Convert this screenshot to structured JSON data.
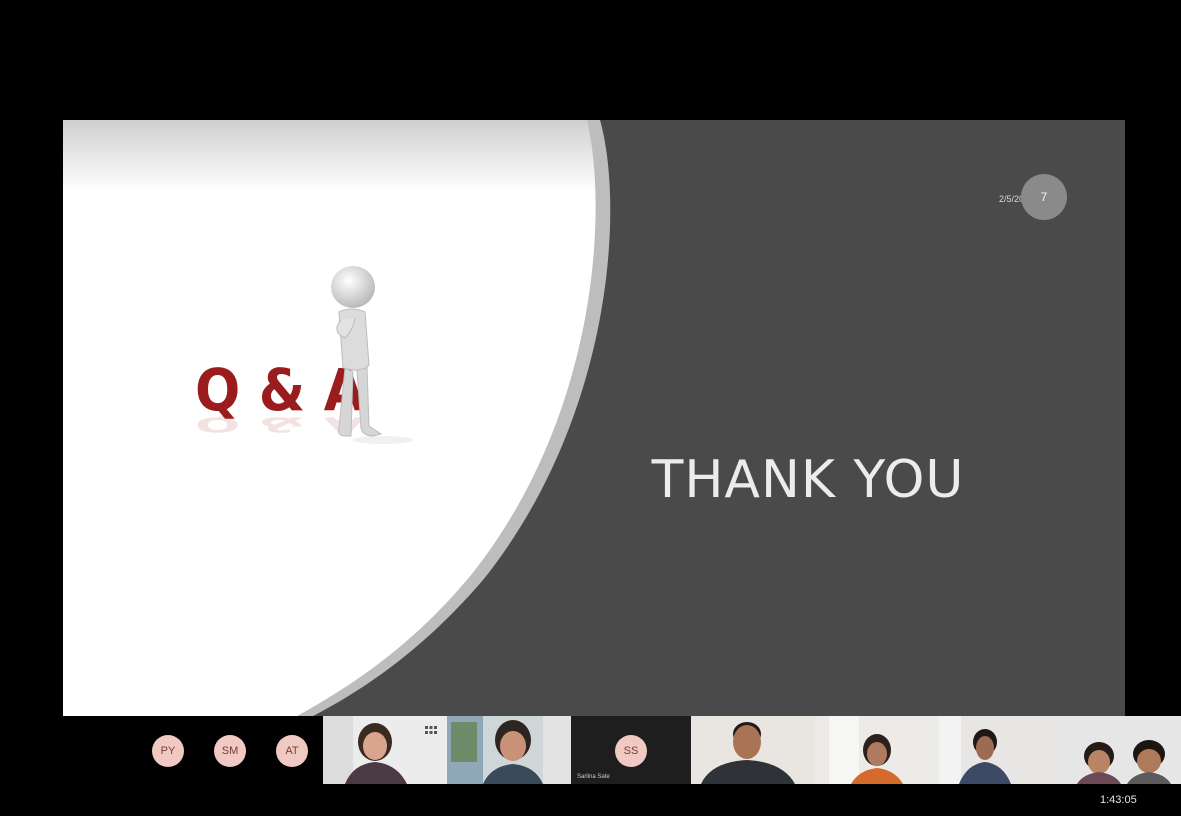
{
  "slide": {
    "date": "2/5/2022",
    "number": "7",
    "title": "THANK YOU",
    "graphic_letters": "Q & A"
  },
  "participants": {
    "avatars": [
      {
        "initials": "PY"
      },
      {
        "initials": "SM"
      },
      {
        "initials": "AT"
      },
      {
        "initials": "SS"
      }
    ],
    "ss_tile_name": "Sarlina Sate"
  },
  "meeting": {
    "elapsed_time": "1:43:05"
  },
  "colors": {
    "background": "#000000",
    "slide_dark": "#4a4a4a",
    "qa_red": "#9b1c1c",
    "avatar_bg": "#f0c9c3"
  }
}
